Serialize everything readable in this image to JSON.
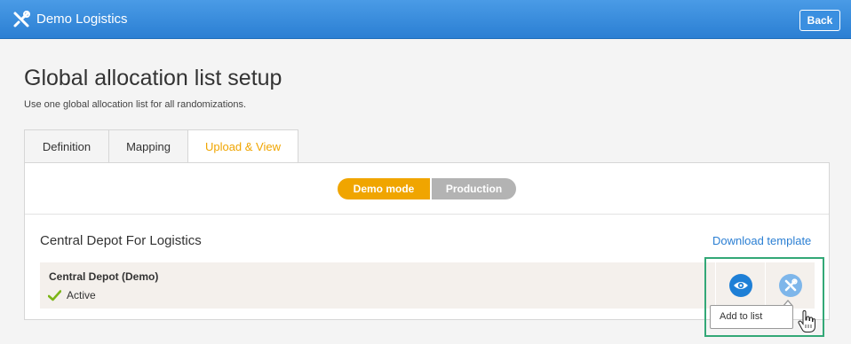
{
  "app": {
    "title": "Demo Logistics",
    "back_label": "Back",
    "logo_icon": "tools-icon"
  },
  "page": {
    "title": "Global allocation list setup",
    "subtitle": "Use one global allocation list for all randomizations."
  },
  "tabs": [
    {
      "label": "Definition",
      "active": false
    },
    {
      "label": "Mapping",
      "active": false
    },
    {
      "label": "Upload & View",
      "active": true
    }
  ],
  "mode_toggle": {
    "demo_label": "Demo mode",
    "production_label": "Production",
    "selected": "Demo mode"
  },
  "section": {
    "title": "Central Depot For Logistics",
    "download_label": "Download template"
  },
  "depot": {
    "name": "Central Depot (Demo)",
    "status": "Active",
    "status_icon": "checkmark-icon"
  },
  "actions": {
    "view_icon": "eye-icon",
    "tools_icon": "tools-icon",
    "tooltip": "Add to list"
  },
  "colors": {
    "topbar": "#2b7fd3",
    "accent": "#f0a500",
    "link": "#2b7fd3",
    "highlight": "#33a877",
    "active_check": "#7cb518"
  }
}
